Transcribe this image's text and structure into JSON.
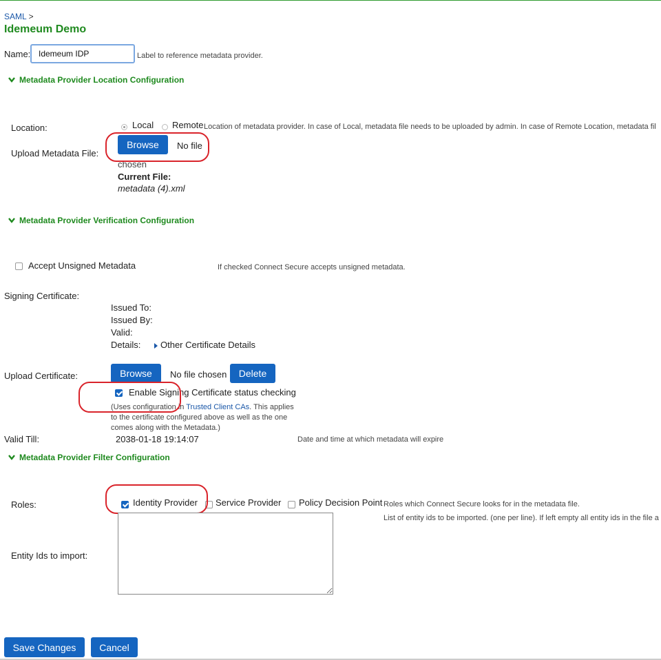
{
  "breadcrumb": {
    "parent": "SAML",
    "separator": ">"
  },
  "page_title": "Idemeum Demo",
  "name_field": {
    "label": "Name:",
    "value": "Idemeum IDP",
    "hint": "Label to reference metadata provider."
  },
  "sections": {
    "location": "Metadata Provider Location Configuration",
    "verification": "Metadata Provider Verification Configuration",
    "filter": "Metadata Provider Filter Configuration"
  },
  "location": {
    "label": "Location:",
    "options": [
      "Local",
      "Remote"
    ],
    "selected": "Local",
    "hint": "Location of metadata provider. In case of Local, metadata file needs to be uploaded by admin. In case of Remote Location, metadata fil"
  },
  "upload_metadata": {
    "label": "Upload Metadata File:",
    "browse": "Browse",
    "file_status_1": "No file",
    "file_status_2": "chosen",
    "current_file_label": "Current File:",
    "current_file": "metadata (4).xml"
  },
  "unsigned": {
    "label": "Accept Unsigned Metadata",
    "checked": false,
    "hint": "If checked Connect Secure accepts unsigned metadata."
  },
  "signing_cert": {
    "label": "Signing Certificate:",
    "issued_to": "Issued To:",
    "issued_by": "Issued By:",
    "valid": "Valid:",
    "details": "Details:",
    "details_link": "Other Certificate Details"
  },
  "upload_cert": {
    "label": "Upload Certificate:",
    "browse": "Browse",
    "file_status": "No file chosen",
    "delete": "Delete"
  },
  "status_check": {
    "label": "Enable Signing Certificate status checking",
    "checked": true,
    "note_pre": "(Uses configuration in ",
    "note_link": "Trusted Client CAs",
    "note_post": ". This applies",
    "note_line2": "to the certificate configured above as well as the one",
    "note_line3": "comes along with the Metadata.)"
  },
  "valid_till": {
    "label": "Valid Till:",
    "value": "2038-01-18 19:14:07",
    "hint": "Date and time at which metadata will expire"
  },
  "roles": {
    "label": "Roles:",
    "options": [
      {
        "label": "Identity Provider",
        "checked": true
      },
      {
        "label": "Service Provider",
        "checked": false
      },
      {
        "label": "Policy Decision Point",
        "checked": false
      }
    ],
    "hint": "Roles which Connect Secure looks for in the metadata file."
  },
  "entity_ids": {
    "label": "Entity Ids to import:",
    "hint": "List of entity ids to be imported. (one per line). If left empty all entity ids in the file a",
    "value": ""
  },
  "footer": {
    "save": "Save Changes",
    "cancel": "Cancel"
  },
  "colors": {
    "accent_green": "#1f8a1f",
    "button_blue": "#1565c0",
    "highlight_red": "#d9232a",
    "link_blue": "#1a57a8"
  }
}
